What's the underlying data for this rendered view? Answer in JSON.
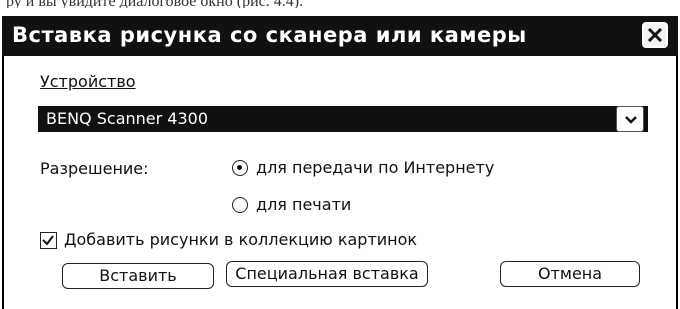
{
  "top_text": "ру и вы увидите диалоговое окно (рис. 4.4).",
  "dialog": {
    "title": "Вставка рисунка со сканера или камеры",
    "device_label": "Устройство",
    "device_value": "BENQ Scanner 4300",
    "resolution_label": "Разрешение:",
    "resolution_options": [
      {
        "label": "для передачи по Интернету",
        "selected": true
      },
      {
        "label": "для печати",
        "selected": false
      }
    ],
    "add_to_collection": {
      "label": "Добавить рисунки в коллекцию картинок",
      "checked": true
    },
    "buttons": {
      "insert": "Вставить",
      "special_insert": "Специальная вставка",
      "cancel": "Отмена"
    }
  },
  "icons": {
    "close": "close-icon",
    "dropdown": "chevron-down-icon",
    "check": "checkmark-icon"
  }
}
